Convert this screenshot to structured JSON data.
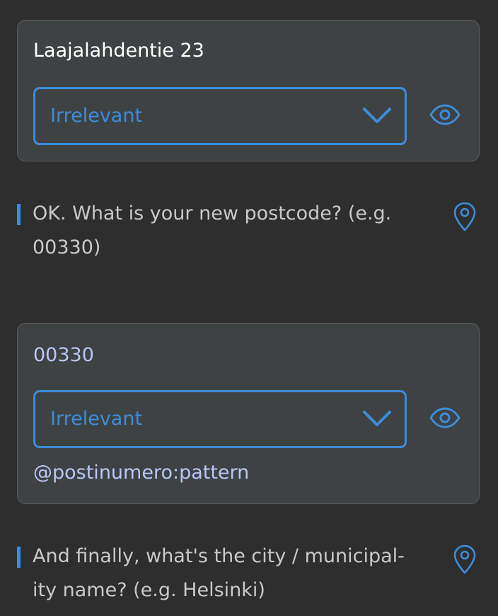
{
  "messages": [
    {
      "user_text": "Laajalahdentie 23",
      "select_value": "Irrelevant"
    },
    {
      "bot_text": "OK. What is your new postcode? (e.g. 00330)"
    },
    {
      "user_text": "00330",
      "select_value": "Irrelevant",
      "pattern": "@postinumero:pattern"
    },
    {
      "bot_text_line1": "And finally, what's the city / municipal-",
      "bot_text_line2": "ity name? (e.g. Helsinki)"
    }
  ],
  "colors": {
    "accent": "#3d8ddb",
    "background": "#2e2e2e",
    "card": "#3f4243",
    "entity_text": "#b9c6f7"
  },
  "icons": [
    "chevron-down-icon",
    "eye-icon",
    "map-pin-icon"
  ]
}
